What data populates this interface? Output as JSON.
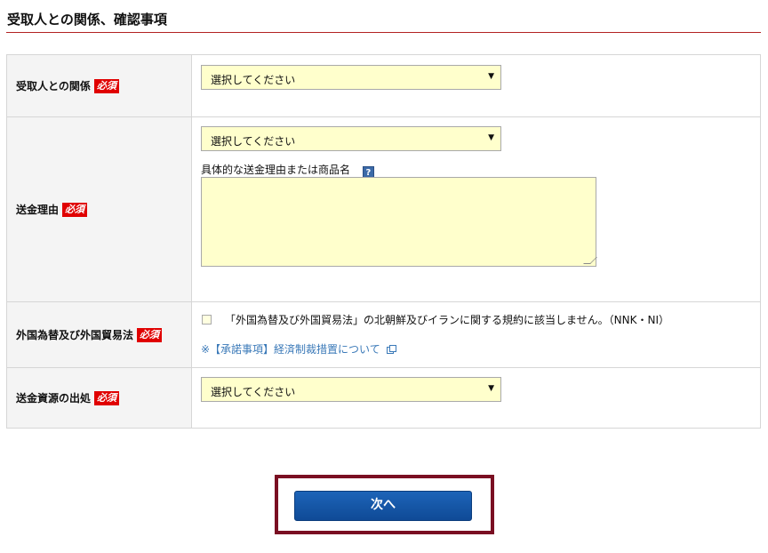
{
  "section_title": "受取人との関係、確認事項",
  "required_badge": "必須",
  "rows": {
    "relationship": {
      "label": "受取人との関係",
      "select_value": "選択してください"
    },
    "reason": {
      "label": "送金理由",
      "select_value": "選択してください",
      "detail_label": "具体的な送金理由または商品名",
      "help_icon": "?",
      "detail_value": ""
    },
    "fx_law": {
      "label": "外国為替及び外国貿易法",
      "checkbox_text": "「外国為替及び外国貿易法」の北朝鮮及びイランに関する規約に該当しません。（NNK・NI）",
      "checked": false,
      "link_text": "※【承諾事項】経済制裁措置について"
    },
    "fund_source": {
      "label": "送金資源の出処",
      "select_value": "選択してください"
    }
  },
  "next_button": "次へ",
  "colors": {
    "required_bg": "#e00000",
    "field_bg": "#ffffcc",
    "button": "#1a5aa8",
    "frame": "#7a0f22",
    "link": "#3a79b8"
  }
}
